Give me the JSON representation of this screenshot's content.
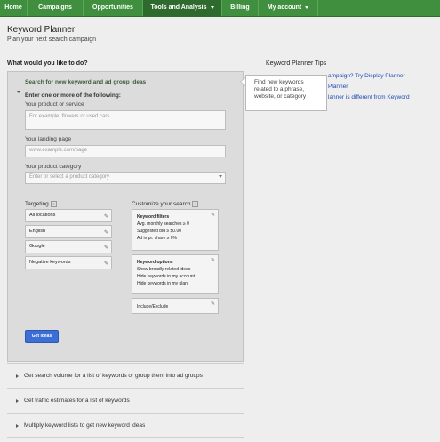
{
  "nav": {
    "tabs": [
      {
        "label": "Home"
      },
      {
        "label": "Campaigns"
      },
      {
        "label": "Opportunities"
      },
      {
        "label": "Tools and Analysis"
      },
      {
        "label": "Billing"
      },
      {
        "label": "My account"
      }
    ],
    "active": "Tools and Analysis",
    "bar_color": "#3f8f3f",
    "active_color": "#2e6a2e"
  },
  "page": {
    "title": "Keyword Planner",
    "subtitle": "Plan your next search campaign",
    "question": "What would you like to do?"
  },
  "search_section": {
    "header": "Search for new keyword and ad group ideas",
    "enter_prompt": "Enter one or more of the following:",
    "product_label": "Your product or service",
    "product_placeholder": "For example, flowers or used cars",
    "landing_label": "Your landing page",
    "landing_placeholder": "www.example.com/page",
    "category_label": "Your product category",
    "category_placeholder": "Enter or select a product category",
    "targeting_label": "Targeting",
    "targeting": [
      {
        "label": "All locations"
      },
      {
        "label": "English"
      },
      {
        "label": "Google"
      },
      {
        "label": "Negative keywords"
      }
    ],
    "customize_label": "Customize your search",
    "keyword_filters": {
      "title": "Keyword filters",
      "lines": [
        "Avg. monthly searches ≥ 0",
        "Suggested bid ≥ $0.00",
        "Ad impr. share ≥ 0%"
      ]
    },
    "keyword_options": {
      "title": "Keyword options",
      "lines": [
        "Show broadly related ideas",
        "Hide keywords in my account",
        "Hide keywords in my plan"
      ]
    },
    "include_exclude": "Include/Exclude",
    "get_ideas": "Get ideas",
    "button_color": "#3b6fd6"
  },
  "collapsed_sections": [
    {
      "label": "Get search volume for a list of keywords or group them into ad groups"
    },
    {
      "label": "Get traffic estimates for a list of keywords"
    },
    {
      "label": "Multiply keyword lists to get new keyword ideas"
    }
  ],
  "tips": {
    "title": "Keyword Planner Tips",
    "links": [
      {
        "label": "ampaign? Try Display Planner"
      },
      {
        "label": "Planner"
      },
      {
        "label": "lanner is different from Keyword"
      }
    ]
  },
  "tooltip": {
    "text": "Find new keywords related to a phrase, website, or category"
  }
}
